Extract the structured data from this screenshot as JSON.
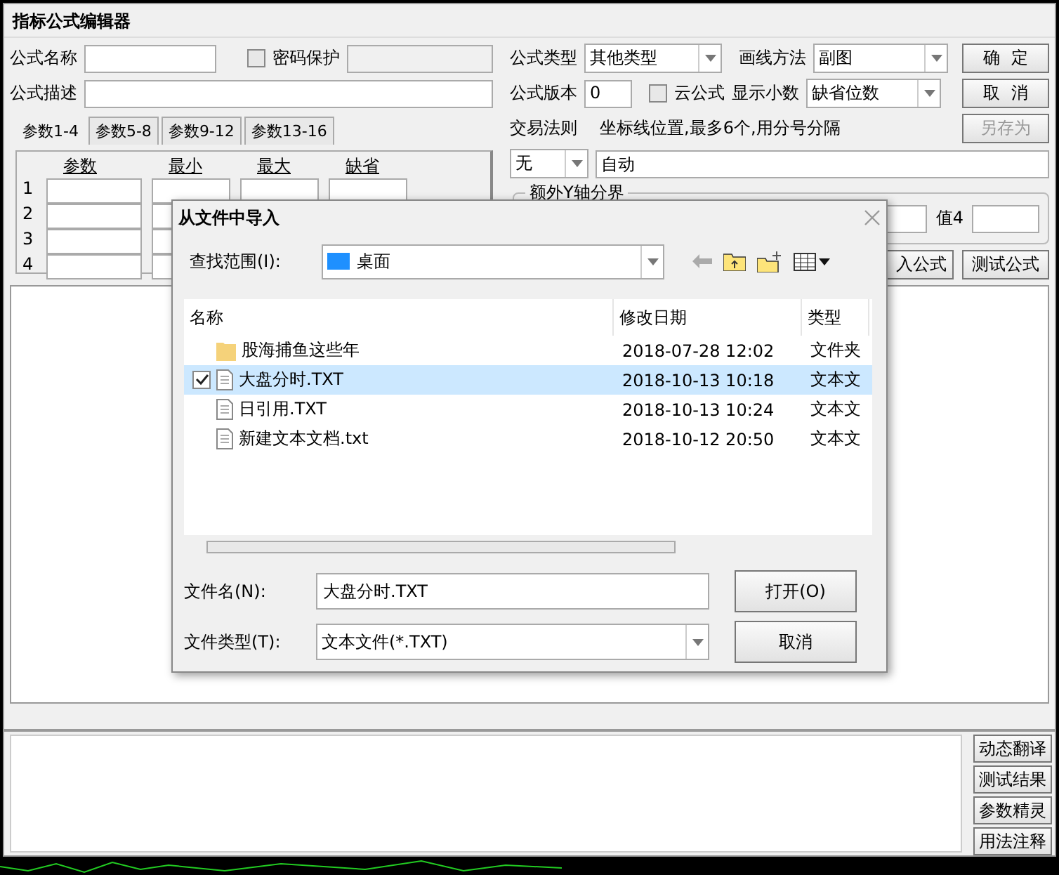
{
  "window": {
    "title": "指标公式编辑器"
  },
  "form": {
    "name_label": "公式名称",
    "password": {
      "label": "密码保护",
      "checked": false
    },
    "type_label": "公式类型",
    "type_value": "其他类型",
    "draw_label": "画线方法",
    "draw_value": "副图",
    "ok": "确  定",
    "desc_label": "公式描述",
    "version_label": "公式版本",
    "version_value": "0",
    "cloud": {
      "label": "云公式",
      "checked": false
    },
    "decimals_label": "显示小数",
    "decimals_value": "缺省位数",
    "cancel": "取  消",
    "save_as": {
      "label": "另存为",
      "disabled": true
    },
    "trade_label": "交易法则",
    "trade_value": "无",
    "axis_label": "坐标线位置,最多6个,用分号分隔",
    "axis_value": "自动",
    "yaxis": {
      "title": "额外Y轴分界",
      "value4_label": "值4"
    },
    "import": "入公式",
    "test": "测试公式"
  },
  "param_tabs": [
    {
      "label": "参数1-4",
      "selected": true
    },
    {
      "label": "参数5-8",
      "selected": false
    },
    {
      "label": "参数9-12",
      "selected": false
    },
    {
      "label": "参数13-16",
      "selected": false
    }
  ],
  "param_table": {
    "columns": [
      "参数",
      "最小",
      "最大",
      "缺省"
    ],
    "rows": [
      "1",
      "2",
      "3",
      "4"
    ]
  },
  "side_buttons": [
    "动态翻译",
    "测试结果",
    "参数精灵",
    "用法注释"
  ],
  "dialog": {
    "title": "从文件中导入",
    "look_in_label": "查找范围(I):",
    "look_in_value": "桌面",
    "columns": [
      "名称",
      "修改日期",
      "类型"
    ],
    "files": [
      {
        "kind": "folder",
        "name": "股海捕鱼这些年",
        "date": "2018-07-28 12:02",
        "type": "文件夹",
        "selected": false,
        "checked": false
      },
      {
        "kind": "file",
        "name": "大盘分时.TXT",
        "date": "2018-10-13 10:18",
        "type": "文本文",
        "selected": true,
        "checked": true
      },
      {
        "kind": "file",
        "name": "日引用.TXT",
        "date": "2018-10-13 10:24",
        "type": "文本文",
        "selected": false,
        "checked": false
      },
      {
        "kind": "file",
        "name": "新建文本文档.txt",
        "date": "2018-10-12 20:50",
        "type": "文本文",
        "selected": false,
        "checked": false
      }
    ],
    "filename_label": "文件名(N):",
    "filename_value": "大盘分时.TXT",
    "filetype_label": "文件类型(T):",
    "filetype_value": "文本文件(*.TXT)",
    "open": "打开(O)",
    "cancel": "取消"
  }
}
